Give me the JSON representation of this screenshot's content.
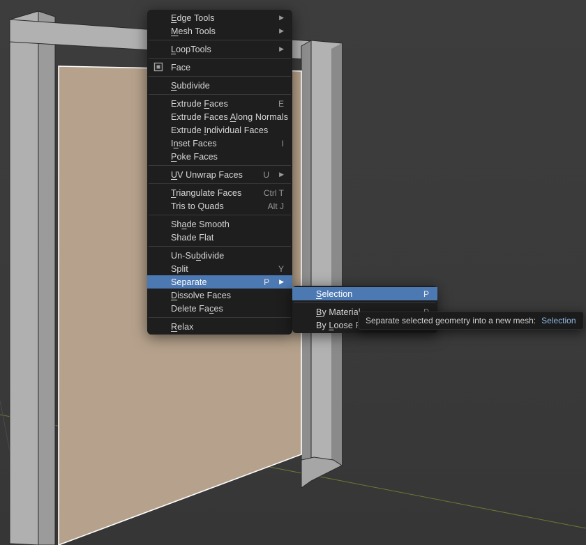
{
  "context_menu": {
    "top_items": [
      {
        "label": "Edge Tools",
        "underline": 0,
        "submenu": true
      },
      {
        "label": "Mesh Tools",
        "underline": 0,
        "submenu": true
      }
    ],
    "looptools": {
      "label": "LoopTools",
      "underline": 0,
      "submenu": true
    },
    "face": {
      "label": "Face",
      "icon": "face"
    },
    "subdivide": {
      "label": "Subdivide",
      "underline": 0
    },
    "extrude": {
      "faces": {
        "label": "Extrude Faces",
        "underline": 8,
        "shortcut": "E"
      },
      "along_normals": {
        "label": "Extrude Faces Along Normals",
        "underline": 14
      },
      "individual": {
        "label": "Extrude Individual Faces",
        "underline": 8
      }
    },
    "inset": {
      "label": "Inset Faces",
      "underline": 1,
      "shortcut": "I"
    },
    "poke": {
      "label": "Poke Faces",
      "underline": 0
    },
    "uv": {
      "label": "UV Unwrap Faces",
      "underline": 0,
      "shortcut": "U",
      "submenu": true
    },
    "triangulate": {
      "label": "Triangulate Faces",
      "underline": 0,
      "shortcut": "Ctrl T"
    },
    "trisquads": {
      "label": "Tris to Quads",
      "shortcut": "Alt J"
    },
    "shade_smooth": {
      "label": "Shade Smooth",
      "underline": 2
    },
    "shade_flat": {
      "label": "Shade Flat"
    },
    "unsubdivide": {
      "label": "Un-Subdivide",
      "underline": 6
    },
    "split": {
      "label": "Split",
      "shortcut": "Y"
    },
    "separate": {
      "label": "Separate",
      "shortcut": "P",
      "submenu": true,
      "highlight": true
    },
    "dissolve": {
      "label": "Dissolve Faces",
      "underline": 0
    },
    "delete": {
      "label": "Delete Faces",
      "underline": 10
    },
    "relax": {
      "label": "Relax",
      "underline": 0
    }
  },
  "submenu": {
    "selection": {
      "label": "Selection",
      "underline": 0,
      "shortcut": "P",
      "highlight": true
    },
    "bymaterial": {
      "label": "By Material",
      "underline": 0,
      "shortcut": "P"
    },
    "byloose": {
      "label": "By Loose Parts",
      "underline": 3,
      "shortcut": "P"
    }
  },
  "tooltip": {
    "desc": "Separate selected geometry into a new mesh:",
    "name": "Selection"
  }
}
